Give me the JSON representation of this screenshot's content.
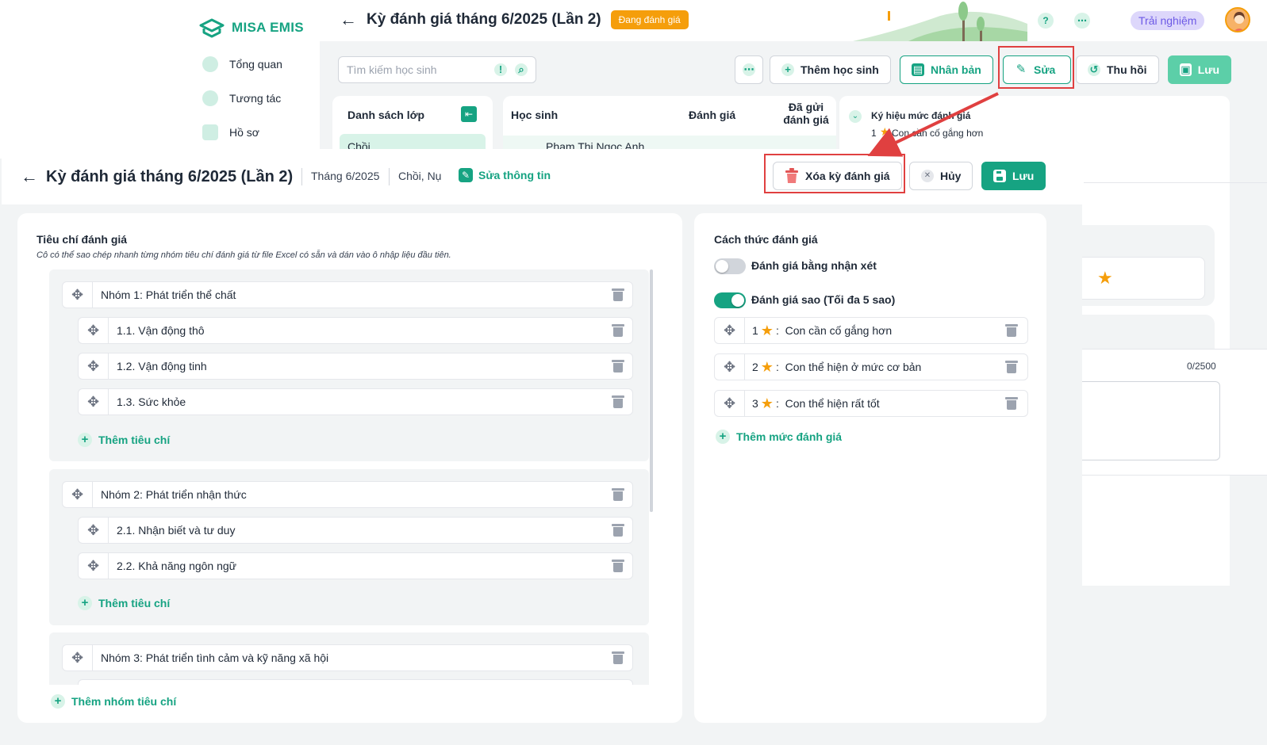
{
  "brand": {
    "name": "MISA EMIS"
  },
  "bg_sidebar": {
    "items": [
      {
        "label": "Tổng quan"
      },
      {
        "label": "Tương tác"
      },
      {
        "label": "Hồ sơ"
      }
    ]
  },
  "bg_header": {
    "title": "Kỳ đánh giá tháng 6/2025 (Lần 2)",
    "status": "Đang đánh giá",
    "trial": "Trải nghiệm"
  },
  "bg_toolbar": {
    "search_placeholder": "Tìm kiếm học sinh",
    "add_student": "Thêm học sinh",
    "duplicate": "Nhân bản",
    "edit": "Sửa",
    "revoke": "Thu hồi",
    "save": "Lưu"
  },
  "bg_class_list": {
    "title": "Danh sách lớp",
    "first_item": "Chồi"
  },
  "bg_student_table": {
    "headers": [
      "Học sinh",
      "Đánh giá",
      "Đã gửi đánh giá"
    ],
    "first_row": "Phạm Thị Ngọc Anh"
  },
  "bg_legend": {
    "title": "Ký hiệu mức đánh giá",
    "first_level_num": "1",
    "first_level_text": "Con cần cố gắng hơn"
  },
  "bg_right": {
    "counter": "0/2500"
  },
  "edit_panel": {
    "title": "Kỳ đánh giá tháng 6/2025 (Lần 2)",
    "month": "Tháng 6/2025",
    "classes": "Chồi, Nụ",
    "edit_info": "Sửa thông tin",
    "delete_button": "Xóa kỳ đánh giá",
    "cancel_button": "Hủy",
    "save_button": "Lưu"
  },
  "criteria": {
    "title": "Tiêu chí đánh giá",
    "hint": "Cô có thể sao chép nhanh từng nhóm tiêu chí đánh giá từ file Excel có sẵn và dán vào ô nhập liệu đầu tiên.",
    "groups": [
      {
        "name": "Nhóm 1: Phát triển thể chất",
        "items": [
          "1.1. Vận động thô",
          "1.2. Vận động tinh",
          "1.3. Sức khỏe"
        ]
      },
      {
        "name": "Nhóm 2: Phát triển nhận thức",
        "items": [
          "2.1. Nhận biết và tư duy",
          "2.2. Khả năng ngôn ngữ"
        ]
      },
      {
        "name": "Nhóm 3: Phát triển tình cảm và kỹ năng xã hội",
        "items": []
      }
    ],
    "add_criterion": "Thêm tiêu chí",
    "add_group": "Thêm nhóm tiêu chí"
  },
  "method": {
    "title": "Cách thức đánh giá",
    "comment_toggle": {
      "label": "Đánh giá bằng nhận xét",
      "on": false
    },
    "star_toggle": {
      "label": "Đánh giá sao (Tối đa 5 sao)",
      "on": true
    },
    "levels": [
      {
        "num": "1",
        "text": "Con cần cố gắng hơn"
      },
      {
        "num": "2",
        "text": "Con thể hiện ở mức cơ bản"
      },
      {
        "num": "3",
        "text": "Con thể hiện rất tốt"
      }
    ],
    "add_level": "Thêm mức đánh giá"
  },
  "colors": {
    "accent": "#16a382",
    "status": "#f59e0b",
    "highlight": "#e04040",
    "star": "#f59e0b"
  }
}
